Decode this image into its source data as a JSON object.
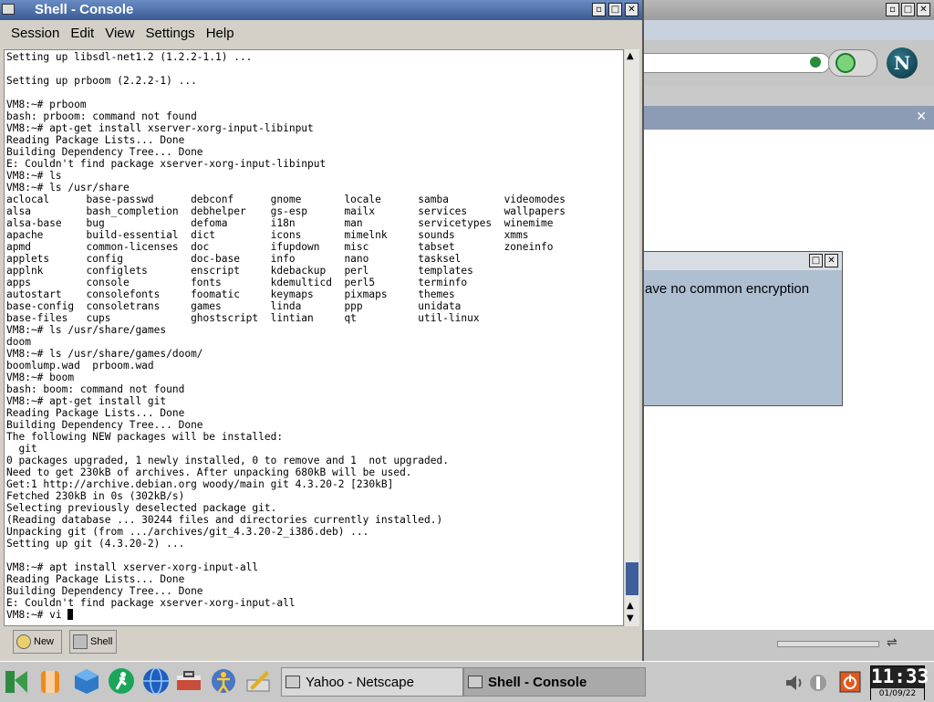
{
  "console": {
    "title": "Shell - Console",
    "menu": [
      "Session",
      "Edit",
      "View",
      "Settings",
      "Help"
    ],
    "terminal_lines": [
      "Setting up libsdl-net1.2 (1.2.2-1.1) ...",
      "",
      "Setting up prboom (2.2.2-1) ...",
      "",
      "VM8:~# prboom",
      "bash: prboom: command not found",
      "VM8:~# apt-get install xserver-xorg-input-libinput",
      "Reading Package Lists... Done",
      "Building Dependency Tree... Done",
      "E: Couldn't find package xserver-xorg-input-libinput",
      "VM8:~# ls",
      "VM8:~# ls /usr/share",
      "aclocal      base-passwd      debconf      gnome       locale      samba         videomodes",
      "alsa         bash_completion  debhelper    gs-esp      mailx       services      wallpapers",
      "alsa-base    bug              defoma       i18n        man         servicetypes  winemime",
      "apache       build-essential  dict         icons       mimelnk     sounds        xmms",
      "apmd         common-licenses  doc          ifupdown    misc        tabset        zoneinfo",
      "applets      config           doc-base     info        nano        tasksel",
      "applnk       configlets       enscript     kdebackup   perl        templates",
      "apps         console          fonts        kdemulticd  perl5       terminfo",
      "autostart    consolefonts     foomatic     keymaps     pixmaps     themes",
      "base-config  consoletrans     games        linda       ppp         unidata",
      "base-files   cups             ghostscript  lintian     qt          util-linux",
      "VM8:~# ls /usr/share/games",
      "doom",
      "VM8:~# ls /usr/share/games/doom/",
      "boomlump.wad  prboom.wad",
      "VM8:~# boom",
      "bash: boom: command not found",
      "VM8:~# apt-get install git",
      "Reading Package Lists... Done",
      "Building Dependency Tree... Done",
      "The following NEW packages will be installed:",
      "  git",
      "0 packages upgraded, 1 newly installed, 0 to remove and 1  not upgraded.",
      "Need to get 230kB of archives. After unpacking 680kB will be used.",
      "Get:1 http://archive.debian.org woody/main git 4.3.20-2 [230kB]",
      "Fetched 230kB in 0s (302kB/s)",
      "Selecting previously deselected package git.",
      "(Reading database ... 30244 files and directories currently installed.)",
      "Unpacking git (from .../archives/git_4.3.20-2_i386.deb) ...",
      "Setting up git (4.3.20-2) ...",
      "",
      "VM8:~# apt install xserver-xorg-input-all",
      "Reading Package Lists... Done",
      "Building Dependency Tree... Done",
      "E: Couldn't find package xserver-xorg-input-all"
    ],
    "prompt_line": "VM8:~# vi ",
    "tabs": [
      {
        "label": "New"
      },
      {
        "label": "Shell"
      }
    ]
  },
  "background_window": {
    "dialog_text": "ave no common encryption",
    "logo_letter": "N"
  },
  "taskbar": {
    "tasks": [
      {
        "label": "Yahoo - Netscape"
      },
      {
        "label": "Shell - Console"
      }
    ],
    "clock_time": "11:33",
    "clock_date": "01/09/22"
  }
}
